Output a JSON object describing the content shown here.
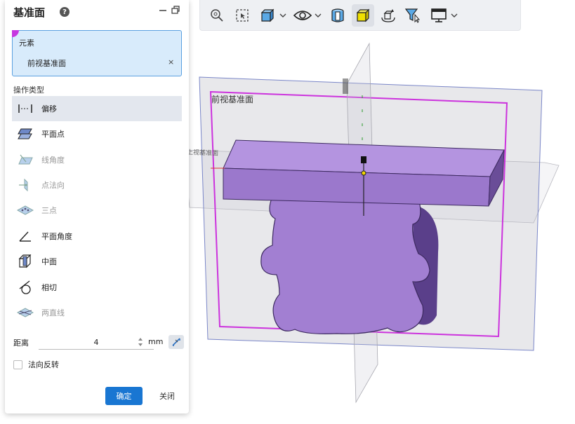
{
  "panel": {
    "title": "基准面",
    "help_icon": "question-circle-icon",
    "element_section_label": "元素",
    "element_value": "前视基准面",
    "element_remove": "×",
    "operation_type_label": "操作类型",
    "operations": [
      {
        "label": "偏移",
        "icon": "offset-icon",
        "selected": true,
        "disabled": false
      },
      {
        "label": "平面点",
        "icon": "plane-point-icon",
        "selected": false,
        "disabled": false
      },
      {
        "label": "线角度",
        "icon": "line-angle-icon",
        "selected": false,
        "disabled": true
      },
      {
        "label": "点法向",
        "icon": "point-normal-icon",
        "selected": false,
        "disabled": true
      },
      {
        "label": "三点",
        "icon": "three-point-icon",
        "selected": false,
        "disabled": true
      },
      {
        "label": "平面角度",
        "icon": "plane-angle-icon",
        "selected": false,
        "disabled": false
      },
      {
        "label": "中面",
        "icon": "mid-plane-icon",
        "selected": false,
        "disabled": false
      },
      {
        "label": "相切",
        "icon": "tangent-icon",
        "selected": false,
        "disabled": false
      },
      {
        "label": "两直线",
        "icon": "two-lines-icon",
        "selected": false,
        "disabled": true
      }
    ],
    "distance_label": "距离",
    "distance_value": "4",
    "distance_unit": "mm",
    "flip_normal_label": "法向反转",
    "flip_normal_checked": false,
    "ok_label": "确定",
    "close_label": "关闭"
  },
  "toolbar": {
    "items": [
      "zoom-fit-icon",
      "zoom-window-icon",
      "view-cube-icon",
      "visibility-eye-icon",
      "section-view-icon",
      "shaded-display-icon",
      "rotate-view-icon",
      "selection-filter-icon",
      "display-monitor-icon"
    ]
  },
  "viewport": {
    "front_plane_label": "前视基准面",
    "top_plane_label": "上视基准面"
  },
  "colors": {
    "accent": "#1976d2",
    "selection_bg": "#d8ebfb",
    "part_fill": "#a07fd0",
    "plane_highlight": "#cc33dd"
  }
}
